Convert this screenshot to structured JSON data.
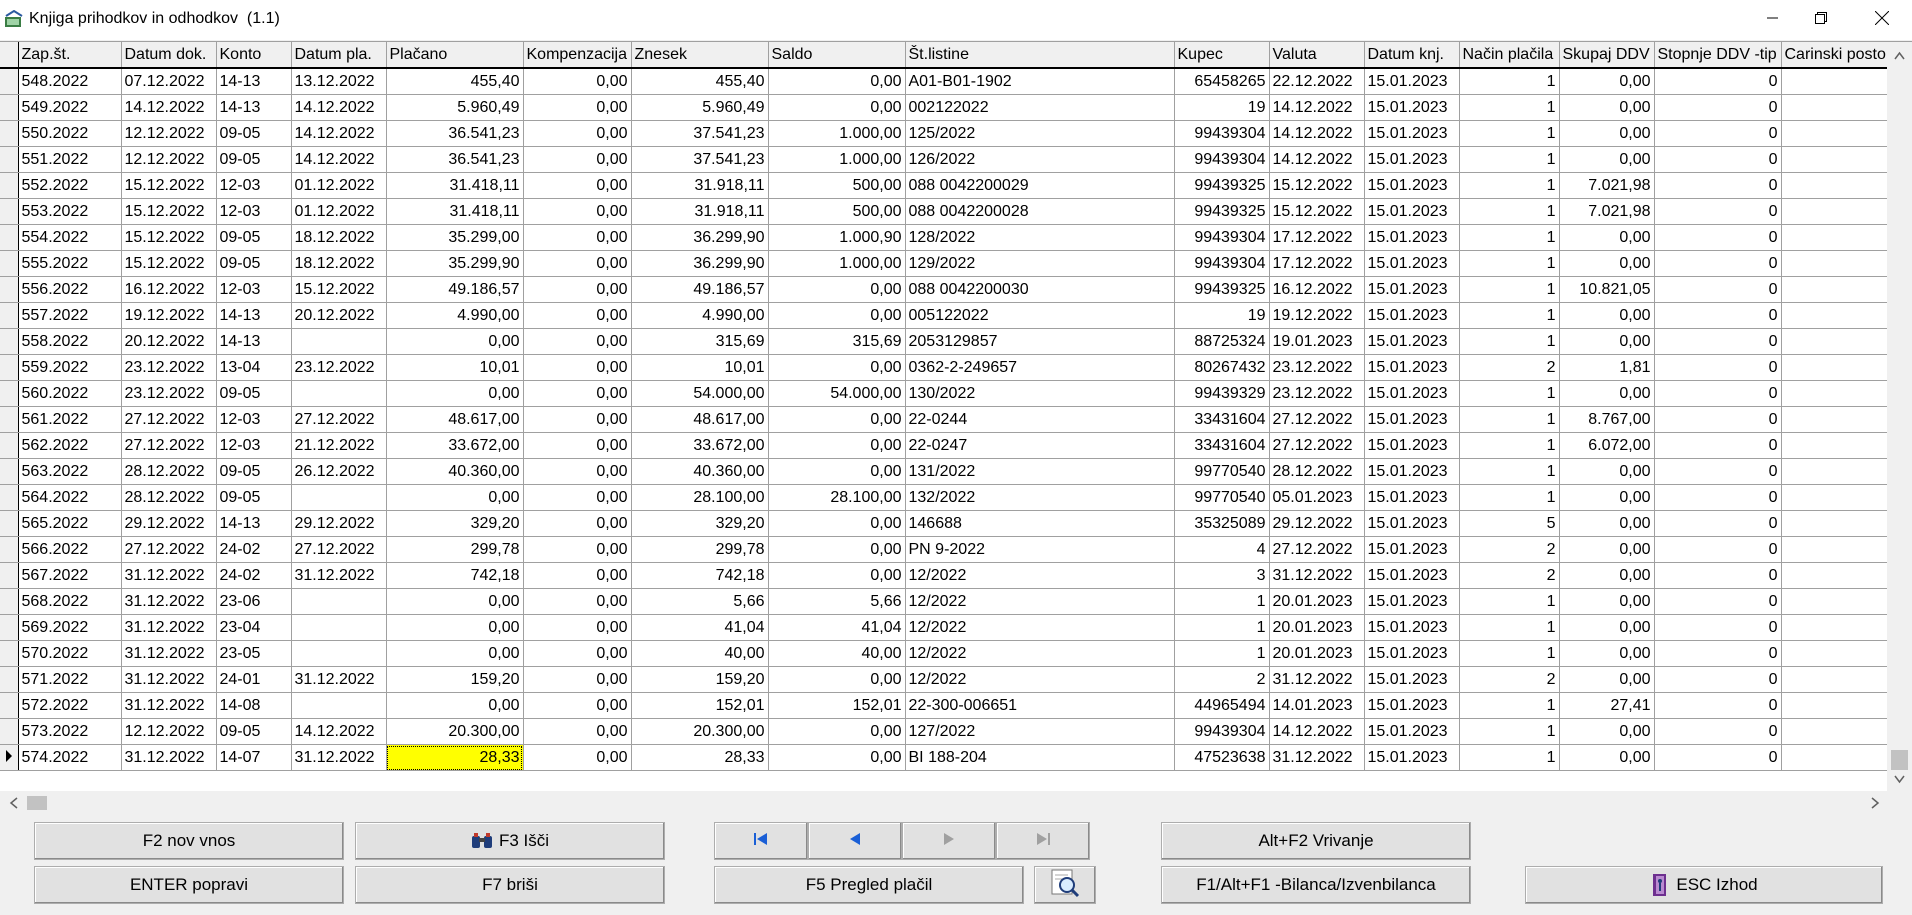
{
  "window": {
    "title": "Knjiga prihodkov in odhodkov  (1.1)"
  },
  "columns": [
    "",
    "Zap.št.",
    "Datum dok.",
    "Konto",
    "Datum pla.",
    "Plačano",
    "Kompenzacija",
    "Znesek",
    "Saldo",
    "Št.listine",
    "Kupec",
    "Valuta",
    "Datum knj.",
    "Način plačila",
    "Skupaj DDV",
    "Stopnje DDV -tip",
    "Carinski posto"
  ],
  "rows": [
    [
      "548.2022",
      "07.12.2022",
      "14-13",
      "13.12.2022",
      "455,40",
      "0,00",
      "455,40",
      "0,00",
      "A01-B01-1902",
      "65458265",
      "22.12.2022",
      "15.01.2023",
      "1",
      "0,00",
      "0",
      ""
    ],
    [
      "549.2022",
      "14.12.2022",
      "14-13",
      "14.12.2022",
      "5.960,49",
      "0,00",
      "5.960,49",
      "0,00",
      "002122022",
      "19",
      "14.12.2022",
      "15.01.2023",
      "1",
      "0,00",
      "0",
      ""
    ],
    [
      "550.2022",
      "12.12.2022",
      "09-05",
      "14.12.2022",
      "36.541,23",
      "0,00",
      "37.541,23",
      "1.000,00",
      "125/2022",
      "99439304",
      "14.12.2022",
      "15.01.2023",
      "1",
      "0,00",
      "0",
      ""
    ],
    [
      "551.2022",
      "12.12.2022",
      "09-05",
      "14.12.2022",
      "36.541,23",
      "0,00",
      "37.541,23",
      "1.000,00",
      "126/2022",
      "99439304",
      "14.12.2022",
      "15.01.2023",
      "1",
      "0,00",
      "0",
      ""
    ],
    [
      "552.2022",
      "15.12.2022",
      "12-03",
      "01.12.2022",
      "31.418,11",
      "0,00",
      "31.918,11",
      "500,00",
      "088 0042200029",
      "99439325",
      "15.12.2022",
      "15.01.2023",
      "1",
      "7.021,98",
      "0",
      ""
    ],
    [
      "553.2022",
      "15.12.2022",
      "12-03",
      "01.12.2022",
      "31.418,11",
      "0,00",
      "31.918,11",
      "500,00",
      "088 0042200028",
      "99439325",
      "15.12.2022",
      "15.01.2023",
      "1",
      "7.021,98",
      "0",
      ""
    ],
    [
      "554.2022",
      "15.12.2022",
      "09-05",
      "18.12.2022",
      "35.299,00",
      "0,00",
      "36.299,90",
      "1.000,90",
      "128/2022",
      "99439304",
      "17.12.2022",
      "15.01.2023",
      "1",
      "0,00",
      "0",
      ""
    ],
    [
      "555.2022",
      "15.12.2022",
      "09-05",
      "18.12.2022",
      "35.299,90",
      "0,00",
      "36.299,90",
      "1.000,00",
      "129/2022",
      "99439304",
      "17.12.2022",
      "15.01.2023",
      "1",
      "0,00",
      "0",
      ""
    ],
    [
      "556.2022",
      "16.12.2022",
      "12-03",
      "15.12.2022",
      "49.186,57",
      "0,00",
      "49.186,57",
      "0,00",
      "088 0042200030",
      "99439325",
      "16.12.2022",
      "15.01.2023",
      "1",
      "10.821,05",
      "0",
      ""
    ],
    [
      "557.2022",
      "19.12.2022",
      "14-13",
      "20.12.2022",
      "4.990,00",
      "0,00",
      "4.990,00",
      "0,00",
      "005122022",
      "19",
      "19.12.2022",
      "15.01.2023",
      "1",
      "0,00",
      "0",
      ""
    ],
    [
      "558.2022",
      "20.12.2022",
      "14-13",
      "",
      "0,00",
      "0,00",
      "315,69",
      "315,69",
      "2053129857",
      "88725324",
      "19.01.2023",
      "15.01.2023",
      "1",
      "0,00",
      "0",
      ""
    ],
    [
      "559.2022",
      "23.12.2022",
      "13-04",
      "23.12.2022",
      "10,01",
      "0,00",
      "10,01",
      "0,00",
      "0362-2-249657",
      "80267432",
      "23.12.2022",
      "15.01.2023",
      "2",
      "1,81",
      "0",
      ""
    ],
    [
      "560.2022",
      "23.12.2022",
      "09-05",
      "",
      "0,00",
      "0,00",
      "54.000,00",
      "54.000,00",
      "130/2022",
      "99439329",
      "23.12.2022",
      "15.01.2023",
      "1",
      "0,00",
      "0",
      ""
    ],
    [
      "561.2022",
      "27.12.2022",
      "12-03",
      "27.12.2022",
      "48.617,00",
      "0,00",
      "48.617,00",
      "0,00",
      "22-0244",
      "33431604",
      "27.12.2022",
      "15.01.2023",
      "1",
      "8.767,00",
      "0",
      ""
    ],
    [
      "562.2022",
      "27.12.2022",
      "12-03",
      "21.12.2022",
      "33.672,00",
      "0,00",
      "33.672,00",
      "0,00",
      "22-0247",
      "33431604",
      "27.12.2022",
      "15.01.2023",
      "1",
      "6.072,00",
      "0",
      ""
    ],
    [
      "563.2022",
      "28.12.2022",
      "09-05",
      "26.12.2022",
      "40.360,00",
      "0,00",
      "40.360,00",
      "0,00",
      "131/2022",
      "99770540",
      "28.12.2022",
      "15.01.2023",
      "1",
      "0,00",
      "0",
      ""
    ],
    [
      "564.2022",
      "28.12.2022",
      "09-05",
      "",
      "0,00",
      "0,00",
      "28.100,00",
      "28.100,00",
      "132/2022",
      "99770540",
      "05.01.2023",
      "15.01.2023",
      "1",
      "0,00",
      "0",
      ""
    ],
    [
      "565.2022",
      "29.12.2022",
      "14-13",
      "29.12.2022",
      "329,20",
      "0,00",
      "329,20",
      "0,00",
      "146688",
      "35325089",
      "29.12.2022",
      "15.01.2023",
      "5",
      "0,00",
      "0",
      ""
    ],
    [
      "566.2022",
      "27.12.2022",
      "24-02",
      "27.12.2022",
      "299,78",
      "0,00",
      "299,78",
      "0,00",
      "PN 9-2022",
      "4",
      "27.12.2022",
      "15.01.2023",
      "2",
      "0,00",
      "0",
      ""
    ],
    [
      "567.2022",
      "31.12.2022",
      "24-02",
      "31.12.2022",
      "742,18",
      "0,00",
      "742,18",
      "0,00",
      "12/2022",
      "3",
      "31.12.2022",
      "15.01.2023",
      "2",
      "0,00",
      "0",
      ""
    ],
    [
      "568.2022",
      "31.12.2022",
      "23-06",
      "",
      "0,00",
      "0,00",
      "5,66",
      "5,66",
      "12/2022",
      "1",
      "20.01.2023",
      "15.01.2023",
      "1",
      "0,00",
      "0",
      ""
    ],
    [
      "569.2022",
      "31.12.2022",
      "23-04",
      "",
      "0,00",
      "0,00",
      "41,04",
      "41,04",
      "12/2022",
      "1",
      "20.01.2023",
      "15.01.2023",
      "1",
      "0,00",
      "0",
      ""
    ],
    [
      "570.2022",
      "31.12.2022",
      "23-05",
      "",
      "0,00",
      "0,00",
      "40,00",
      "40,00",
      "12/2022",
      "1",
      "20.01.2023",
      "15.01.2023",
      "1",
      "0,00",
      "0",
      ""
    ],
    [
      "571.2022",
      "31.12.2022",
      "24-01",
      "31.12.2022",
      "159,20",
      "0,00",
      "159,20",
      "0,00",
      "12/2022",
      "2",
      "31.12.2022",
      "15.01.2023",
      "2",
      "0,00",
      "0",
      ""
    ],
    [
      "572.2022",
      "31.12.2022",
      "14-08",
      "",
      "0,00",
      "0,00",
      "152,01",
      "152,01",
      "22-300-006651",
      "44965494",
      "14.01.2023",
      "15.01.2023",
      "1",
      "27,41",
      "0",
      ""
    ],
    [
      "573.2022",
      "12.12.2022",
      "09-05",
      "14.12.2022",
      "20.300,00",
      "0,00",
      "20.300,00",
      "0,00",
      "127/2022",
      "99439304",
      "14.12.2022",
      "15.01.2023",
      "1",
      "0,00",
      "0",
      ""
    ],
    [
      "574.2022",
      "31.12.2022",
      "14-07",
      "31.12.2022",
      "28,33",
      "0,00",
      "28,33",
      "0,00",
      "BI 188-204",
      "47523638",
      "31.12.2022",
      "15.01.2023",
      "1",
      "0,00",
      "0",
      ""
    ]
  ],
  "current_row": 26,
  "selected_cell_column": 4,
  "colors": {
    "selection": "#ffff00",
    "nav_arrow": "#1a5fd6"
  },
  "buttons": {
    "new": "F2 nov vnos",
    "find": "F3 Išči",
    "insert": "Alt+F2 Vrivanje",
    "edit": "ENTER popravi",
    "delete": "F7 briši",
    "payments": "F5 Pregled plačil",
    "balance": "F1/Alt+F1 -Bilanca/Izvenbilanca",
    "exit": "ESC Izhod"
  },
  "icons": {
    "app": "ledger-app-icon",
    "find": "binoculars-icon",
    "preview": "magnifier-icon",
    "exit": "exit-door-icon"
  }
}
